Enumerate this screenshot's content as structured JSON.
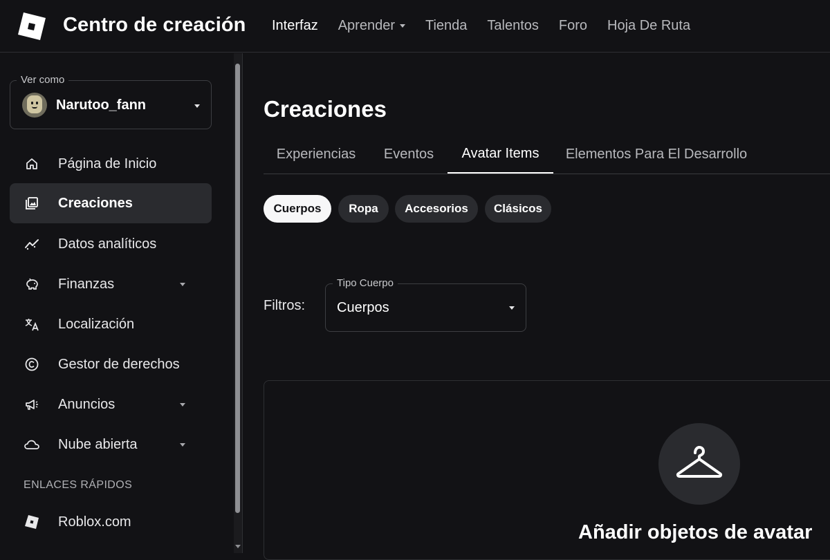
{
  "header": {
    "brand": "Centro de creación",
    "nav": [
      {
        "label": "Interfaz",
        "active": true,
        "dropdown": false
      },
      {
        "label": "Aprender",
        "active": false,
        "dropdown": true
      },
      {
        "label": "Tienda",
        "active": false,
        "dropdown": false
      },
      {
        "label": "Talentos",
        "active": false,
        "dropdown": false
      },
      {
        "label": "Foro",
        "active": false,
        "dropdown": false
      },
      {
        "label": "Hoja De Ruta",
        "active": false,
        "dropdown": false
      }
    ]
  },
  "sidebar": {
    "view_as": {
      "legend": "Ver como",
      "username": "Narutoo_fann"
    },
    "items": [
      {
        "label": "Página de Inicio",
        "icon": "home-icon",
        "active": false,
        "dropdown": false
      },
      {
        "label": "Creaciones",
        "icon": "creations-icon",
        "active": true,
        "dropdown": false
      },
      {
        "label": "Datos analíticos",
        "icon": "analytics-icon",
        "active": false,
        "dropdown": false
      },
      {
        "label": "Finanzas",
        "icon": "piggy-bank-icon",
        "active": false,
        "dropdown": true
      },
      {
        "label": "Localización",
        "icon": "translate-icon",
        "active": false,
        "dropdown": false
      },
      {
        "label": "Gestor de derechos",
        "icon": "copyright-icon",
        "active": false,
        "dropdown": false
      },
      {
        "label": "Anuncios",
        "icon": "megaphone-icon",
        "active": false,
        "dropdown": true
      },
      {
        "label": "Nube abierta",
        "icon": "cloud-icon",
        "active": false,
        "dropdown": true
      }
    ],
    "quick_links_label": "ENLACES RÁPIDOS",
    "quick_links": [
      {
        "label": "Roblox.com",
        "icon": "roblox-icon"
      }
    ]
  },
  "main": {
    "title": "Creaciones",
    "tabs": [
      {
        "label": "Experiencias",
        "active": false
      },
      {
        "label": "Eventos",
        "active": false
      },
      {
        "label": "Avatar Items",
        "active": true
      },
      {
        "label": "Elementos Para El Desarrollo",
        "active": false
      }
    ],
    "chips": [
      {
        "label": "Cuerpos",
        "active": true
      },
      {
        "label": "Ropa",
        "active": false
      },
      {
        "label": "Accesorios",
        "active": false
      },
      {
        "label": "Clásicos",
        "active": false
      }
    ],
    "filters": {
      "label": "Filtros:",
      "body_type_legend": "Tipo Cuerpo",
      "body_type_value": "Cuerpos"
    },
    "empty_state": {
      "icon": "hanger-icon",
      "title": "Añadir objetos de avatar"
    }
  },
  "colors": {
    "background": "#121215",
    "surface": "#2a2b2f",
    "border": "#2e2f33",
    "text": "#ffffff",
    "muted_text": "#b8b9bd"
  }
}
